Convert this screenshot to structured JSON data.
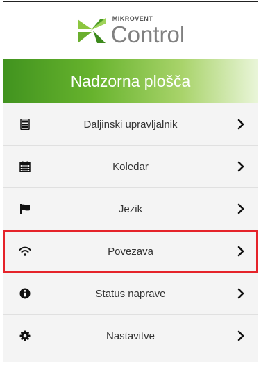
{
  "header": {
    "brand_small": "MIKROVENT",
    "brand_big": "Control",
    "logo_icon": "mikrovent-logo-icon",
    "brand_color": "#41931f"
  },
  "titlebar": {
    "title": "Nadzorna plošča"
  },
  "menu": {
    "items": [
      {
        "label": "Daljinski upravljalnik",
        "icon": "remote-calculator-icon"
      },
      {
        "label": "Koledar",
        "icon": "calendar-icon"
      },
      {
        "label": "Jezik",
        "icon": "flag-icon"
      },
      {
        "label": "Povezava",
        "icon": "wifi-icon",
        "highlighted": true
      },
      {
        "label": "Status naprave",
        "icon": "info-icon"
      },
      {
        "label": "Nastavitve",
        "icon": "gear-icon"
      }
    ],
    "highlight_color": "#e5232a"
  }
}
